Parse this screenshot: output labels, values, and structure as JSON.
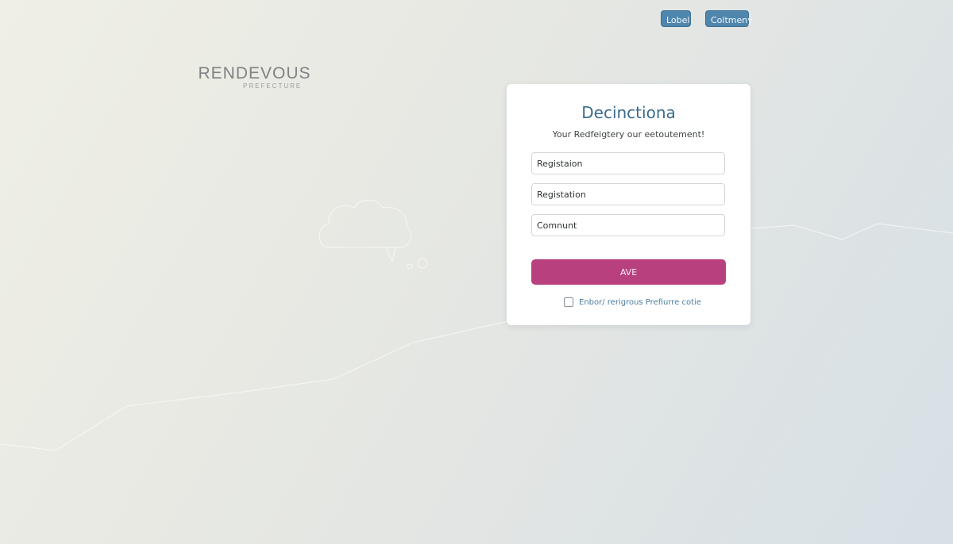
{
  "header": {
    "label_button": "Lobel",
    "company_button": "Coltmeny"
  },
  "brand": {
    "name": "RENDEVOUS",
    "tagline": "PREFECTURE"
  },
  "form": {
    "title": "Decinctiona",
    "subtitle": "Your Redfeigtery our eetoutement!",
    "fields": [
      {
        "value": "Registaion",
        "placeholder": ""
      },
      {
        "value": "Registation",
        "placeholder": ""
      },
      {
        "value": "Comnunt",
        "placeholder": ""
      }
    ],
    "submit_label": "AVE",
    "checkbox_label": "Enbor/ rerigrous Prefiurre cotie",
    "checkbox_checked": false
  },
  "colors": {
    "accent_blue": "#4f86ad",
    "title_blue": "#3b6b8c",
    "submit_magenta": "#b8407e"
  }
}
